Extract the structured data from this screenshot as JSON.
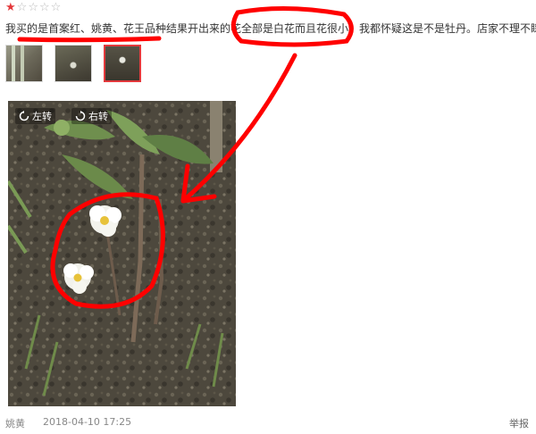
{
  "rating": {
    "filled": 1,
    "total": 5
  },
  "review": {
    "text": "我买的是首案红、姚黄、花王品种结果开出来的花全部是白花而且花很小，我都怀疑这是不是牡丹。店家不理不睬"
  },
  "thumbnails": [
    {
      "name": "thumbnail-1",
      "selected": false
    },
    {
      "name": "thumbnail-2",
      "selected": false
    },
    {
      "name": "thumbnail-3",
      "selected": true
    }
  ],
  "photo": {
    "rotate_left_label": "左转",
    "rotate_right_label": "右转"
  },
  "footer": {
    "user": "姚黄",
    "timestamp": "2018-04-10 17:25",
    "report_label": "举报"
  },
  "colors": {
    "accent": "#e4393c",
    "annotation": "#ff0000"
  }
}
